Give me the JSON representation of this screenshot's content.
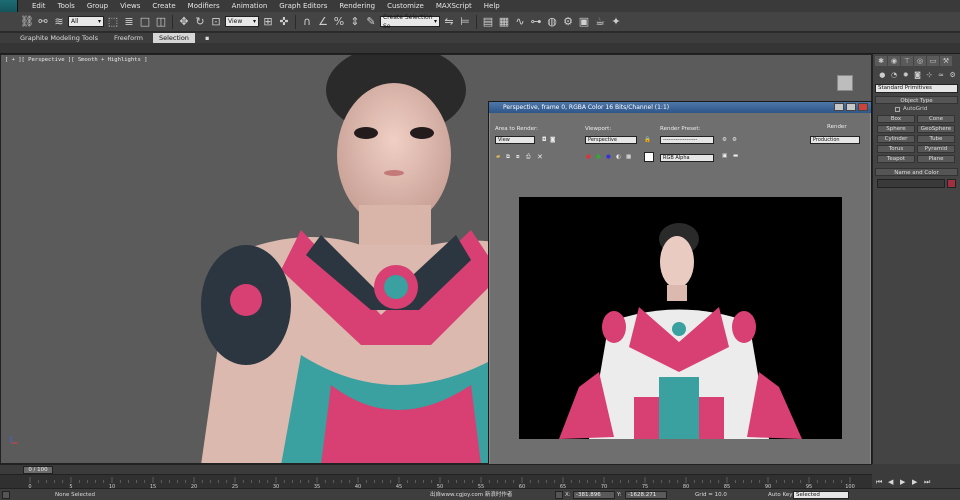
{
  "menubar": {
    "items": [
      "Edit",
      "Tools",
      "Group",
      "Views",
      "Create",
      "Modifiers",
      "Animation",
      "Graph Editors",
      "Rendering",
      "Customize",
      "MAXScript",
      "Help"
    ]
  },
  "toolbar": {
    "filter_value": "All",
    "refcoord_value": "View",
    "selection_set_placeholder": "Create Selection Se"
  },
  "ribbon": {
    "tabs": [
      "Graphite Modeling Tools",
      "Freeform",
      "Selection"
    ],
    "active_tab": "Selection"
  },
  "viewport": {
    "label": "[ + ][ Perspective ][ Smooth + Highlights ]"
  },
  "render_window": {
    "title": "Perspective, frame 0, RGBA Color 16 Bits/Channel (1:1)",
    "area_to_render_label": "Area to Render:",
    "area_to_render_value": "View",
    "viewport_label": "Viewport:",
    "viewport_value": "Perspective",
    "render_preset_label": "Render Preset:",
    "render_preset_value": "-------------------",
    "render_label": "Render",
    "render_mode_value": "Production",
    "channel_value": "RGB Alpha"
  },
  "command_panel": {
    "category_value": "Standard Primitives",
    "object_type_header": "Object Type",
    "autogrid_label": "AutoGrid",
    "buttons": [
      "Box",
      "Cone",
      "Sphere",
      "GeoSphere",
      "Cylinder",
      "Tube",
      "Torus",
      "Pyramid",
      "Teapot",
      "Plane"
    ],
    "name_color_header": "Name and Color",
    "swatch_color": "#a03040"
  },
  "timeline": {
    "frame_display": "0 / 100",
    "ticks": [
      "0",
      "5",
      "10",
      "15",
      "20",
      "25",
      "30",
      "35",
      "40",
      "45",
      "50",
      "55",
      "60",
      "65",
      "70",
      "75",
      "80",
      "85",
      "90",
      "95",
      "100"
    ]
  },
  "statusbar": {
    "selection_status": "None Selected",
    "watermark": "出自www.cgjoy.com 新浪时作者",
    "x_label": "X:",
    "x_value": "-381.896",
    "y_label": "Y:",
    "y_value": "-1628.271",
    "grid_label": "Grid = 10.0",
    "autokey_label": "Auto Key",
    "autokey_value": "Selected"
  }
}
